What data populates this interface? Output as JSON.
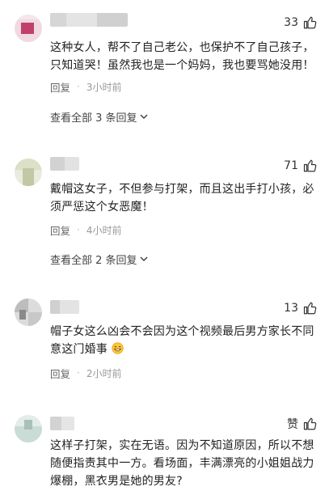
{
  "comments": [
    {
      "likes": "33",
      "text": "这种女人，帮不了自己老公，也保护不了自己孩子，只知道哭！虽然我也是一个妈妈，我也要骂她没用！",
      "reply_label": "回复",
      "time": "3小时前",
      "view_replies": "查看全部 3 条回复"
    },
    {
      "likes": "71",
      "text": "戴帽这女子，不但参与打架，而且这出手打小孩，必须严惩这个女恶魔！",
      "reply_label": "回复",
      "time": "4小时前",
      "view_replies": "查看全部 2 条回复"
    },
    {
      "likes": "13",
      "text": "帽子女这么凶会不会因为这个视频最后男方家长不同意这门婚事",
      "reply_label": "回复",
      "time": "2小时前"
    },
    {
      "likes": "赞",
      "text": "这样子打架，实在无语。因为不知道原因，所以不想随便指责其中一方。看场面，丰满漂亮的小姐姐战力爆棚，黑衣男是她的男友?"
    }
  ],
  "icons": {
    "like": "thumbs-up-icon",
    "expand": "chevron-down-icon",
    "emoji": "grin-emoji-icon"
  },
  "colors": {
    "text": "#222222",
    "meta": "#999999",
    "accent": "#444444"
  }
}
